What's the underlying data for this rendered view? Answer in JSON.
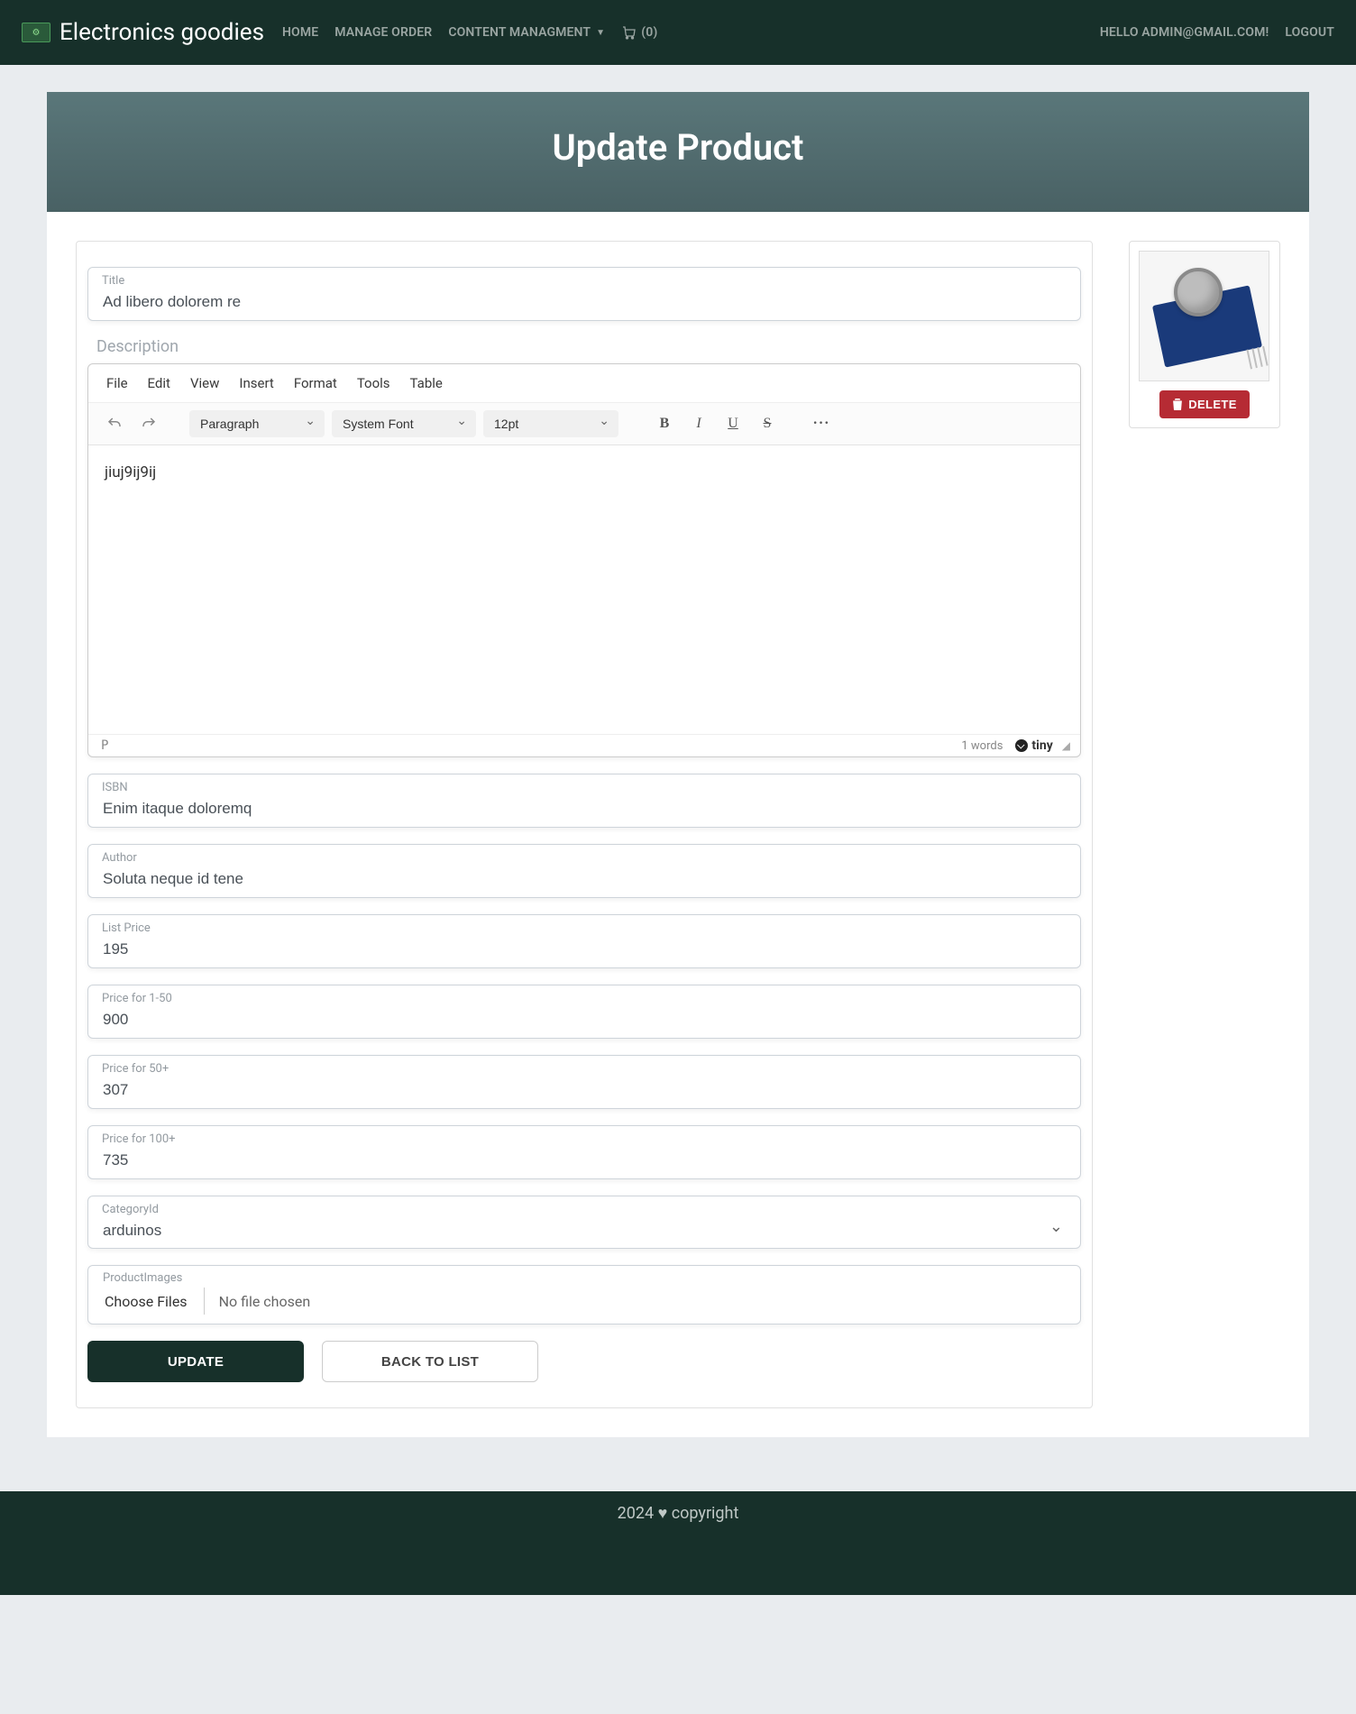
{
  "nav": {
    "brand": "Electronics goodies",
    "links": {
      "home": "HOME",
      "manage_order": "MANAGE ORDER",
      "content_mgmt": "CONTENT MANAGMENT",
      "cart_count": "(0)"
    },
    "right": {
      "greeting": "HELLO ADMIN@GMAIL.COM!",
      "logout": "LOGOUT"
    }
  },
  "header": {
    "title": "Update Product"
  },
  "form": {
    "title": {
      "label": "Title",
      "value": "Ad libero dolorem re"
    },
    "description": {
      "label": "Description",
      "menubar": {
        "file": "File",
        "edit": "Edit",
        "view": "View",
        "insert": "Insert",
        "format": "Format",
        "tools": "Tools",
        "table": "Table"
      },
      "toolbar": {
        "block_format": "Paragraph",
        "font_family": "System Font",
        "font_size": "12pt"
      },
      "content": "jiuj9ij9ij",
      "status": {
        "path": "P",
        "word_count": "1 words",
        "powered": "tiny"
      }
    },
    "isbn": {
      "label": "ISBN",
      "value": "Enim itaque doloremq"
    },
    "author": {
      "label": "Author",
      "value": "Soluta neque id tene"
    },
    "list_price": {
      "label": "List Price",
      "value": "195"
    },
    "price_1_50": {
      "label": "Price for 1-50",
      "value": "900"
    },
    "price_50": {
      "label": "Price for 50+",
      "value": "307"
    },
    "price_100": {
      "label": "Price for 100+",
      "value": "735"
    },
    "category": {
      "label": "CategoryId",
      "value": "arduinos"
    },
    "product_images": {
      "label": "ProductImages",
      "button": "Choose Files",
      "empty": "No file chosen"
    },
    "buttons": {
      "update": "UPDATE",
      "back": "BACK TO LIST"
    }
  },
  "side": {
    "delete": "DELETE"
  },
  "footer": {
    "year": "2024",
    "text": "copyright"
  }
}
